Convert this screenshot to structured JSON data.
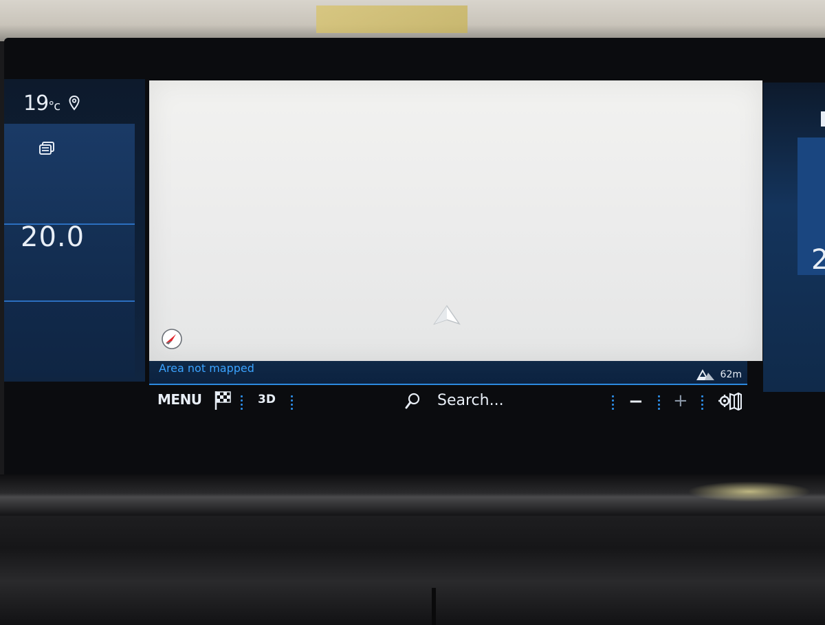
{
  "climate": {
    "exterior_temp": "19",
    "temp_unit": "°c",
    "setpoint": "20.0",
    "right_setpoint_partial": "2"
  },
  "map": {
    "status_text": "Area not mapped",
    "altitude": "62m"
  },
  "toolbar": {
    "menu_label": "MENU",
    "view_mode_label": "3D",
    "search_label": "Search...",
    "zoom_out_label": "−",
    "zoom_in_label": "+"
  },
  "icons": {
    "location": "location-pin-icon",
    "window": "rear-window-defrost-icon",
    "navigation": "navigation-arrow-icon",
    "compass": "compass-icon",
    "altitude": "mountain-icon",
    "destination": "checkered-flag-icon",
    "search": "search-icon",
    "settings": "map-settings-icon"
  },
  "colors": {
    "accent": "#2c8ae0",
    "status_text": "#3ba3ff",
    "map_background": "#ececec",
    "panel_background": "#102541"
  }
}
